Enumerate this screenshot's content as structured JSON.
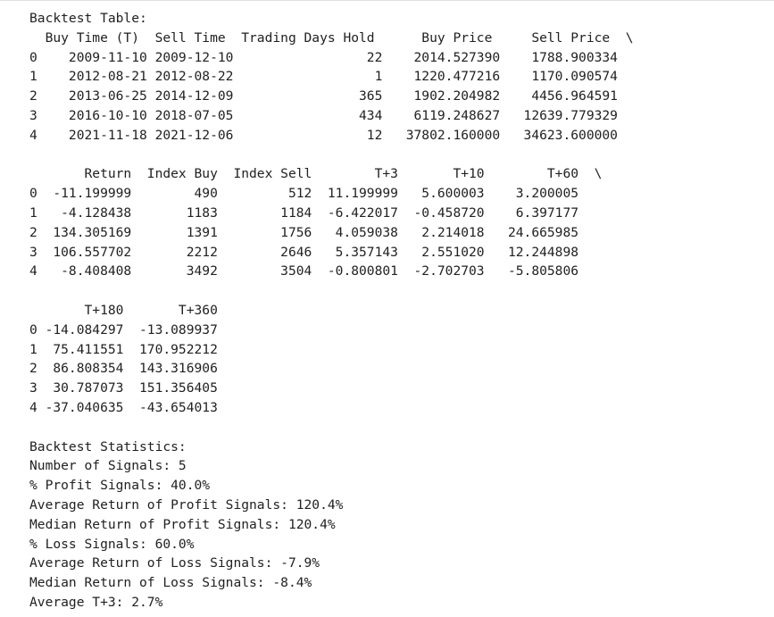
{
  "output": {
    "table_title": "Backtest Table:",
    "block1": {
      "header": "  Buy Time (T)  Sell Time  Trading Days Hold      Buy Price     Sell Price  \\",
      "rows": [
        "0    2009-11-10 2009-12-10                 22    2014.527390    1788.900334  ",
        "1    2012-08-21 2012-08-22                  1    1220.477216    1170.090574  ",
        "2    2013-06-25 2014-12-09                365    1902.204982    4456.964591  ",
        "3    2016-10-10 2018-07-05                434    6119.248627   12639.779329  ",
        "4    2021-11-18 2021-12-06                 12   37802.160000   34623.600000  "
      ]
    },
    "block2": {
      "header": "       Return  Index Buy  Index Sell        T+3       T+10        T+60  \\",
      "rows": [
        "0  -11.199999        490         512  11.199999   5.600003    3.200005  ",
        "1   -4.128438       1183        1184  -6.422017  -0.458720    6.397177  ",
        "2  134.305169       1391        1756   4.059038   2.214018   24.665985  ",
        "3  106.557702       2212        2646   5.357143   2.551020   12.244898  ",
        "4   -8.408408       3492        3504  -0.800801  -2.702703   -5.805806  "
      ]
    },
    "block3": {
      "header": "       T+180       T+360",
      "rows": [
        "0 -14.084297  -13.089937",
        "1  75.411551  170.952212",
        "2  86.808354  143.316906",
        "3  30.787073  151.356405",
        "4 -37.040635  -43.654013"
      ]
    },
    "stats": {
      "title": "Backtest Statistics:",
      "lines": [
        "Number of Signals: 5",
        "% Profit Signals: 40.0%",
        "Average Return of Profit Signals: 120.4%",
        "Median Return of Profit Signals: 120.4%",
        "% Loss Signals: 60.0%",
        "Average Return of Loss Signals: -7.9%",
        "Median Return of Loss Signals: -8.4%",
        "Average T+3: 2.7%"
      ]
    }
  }
}
